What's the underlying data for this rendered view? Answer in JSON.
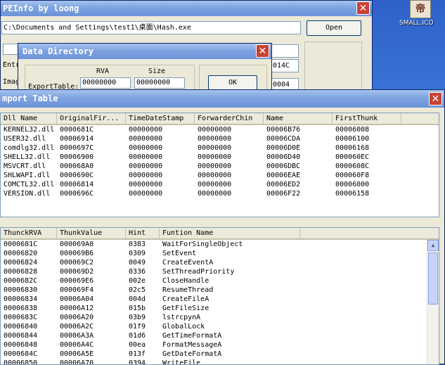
{
  "desktop_icon": {
    "glyph": "帝",
    "label": "SMALL.ICO"
  },
  "peinfo": {
    "title": "PEInfo by loong",
    "path": "C:\\Documents and Settings\\test1\\桌面\\Hash.exe",
    "open_label": "Open",
    "entry_label": "Entr",
    "image_label": "Imag",
    "field_014c": "014C",
    "field_0004": "0004"
  },
  "data_directory": {
    "title": "Data Directory",
    "rva_header": "RVA",
    "size_header": "Size",
    "export_label": "ExportTable:",
    "export_rva": "00000000",
    "export_size": "00000000",
    "ok_label": "OK"
  },
  "import_table": {
    "title": "mport Table",
    "dll_columns": [
      "Dll Name",
      "OriginalFir...",
      "TimeDateStamp",
      "ForwarderChin",
      "Name",
      "FirstThunk"
    ],
    "dll_rows": [
      [
        "KERNEL32.dll",
        "0000681C",
        "00000000",
        "00000000",
        "00006B76",
        "00006008"
      ],
      [
        "USER32.dll",
        "00006914",
        "00000000",
        "00000000",
        "00006CDA",
        "00006100"
      ],
      [
        "comdlg32.dll",
        "0000697C",
        "00000000",
        "00000000",
        "00006D0E",
        "00006168"
      ],
      [
        "SHELL32.dll",
        "00006900",
        "00000000",
        "00000000",
        "00006D40",
        "000060EC"
      ],
      [
        "MSVCRT.dll",
        "000068A0",
        "00000000",
        "00000000",
        "00006DBC",
        "0000608C"
      ],
      [
        "SHLWAPI.dll",
        "0000690C",
        "00000000",
        "00000000",
        "00006EAE",
        "000060F8"
      ],
      [
        "COMCTL32.dll",
        "00006814",
        "00000000",
        "00000000",
        "00006ED2",
        "00006000"
      ],
      [
        "VERSION.dll",
        "0000696C",
        "00000000",
        "00000000",
        "00006F22",
        "00006158"
      ]
    ],
    "func_columns": [
      "ThunckRVA",
      "ThunkValue",
      "Hint",
      "Funtion Name"
    ],
    "func_rows": [
      [
        "0000681C",
        "000069A0",
        "0383",
        "WaitForSingleObject"
      ],
      [
        "00006820",
        "000069B6",
        "0309",
        "SetEvent"
      ],
      [
        "00006824",
        "000069C2",
        "0049",
        "CreateEventA"
      ],
      [
        "00006828",
        "000069D2",
        "0336",
        "SetThreadPriority"
      ],
      [
        "0000682C",
        "000069E6",
        "002e",
        "CloseHandle"
      ],
      [
        "00006830",
        "000069F4",
        "02c5",
        "ResumeThread"
      ],
      [
        "00006834",
        "00006A04",
        "004d",
        "CreateFileA"
      ],
      [
        "00006838",
        "00006A12",
        "015b",
        "GetFileSize"
      ],
      [
        "0000683C",
        "00006A20",
        "03b9",
        "lstrcpynA"
      ],
      [
        "00006840",
        "00006A2C",
        "01f9",
        "GlobalLock"
      ],
      [
        "00006844",
        "00006A3A",
        "01d6",
        "GetTimeFormatA"
      ],
      [
        "00006848",
        "00006A4C",
        "00ea",
        "FormatMessageA"
      ],
      [
        "0000684C",
        "00006A5E",
        "013f",
        "GetDateFormatA"
      ],
      [
        "00006850",
        "00006A70",
        "0394",
        "WriteFile"
      ]
    ]
  }
}
